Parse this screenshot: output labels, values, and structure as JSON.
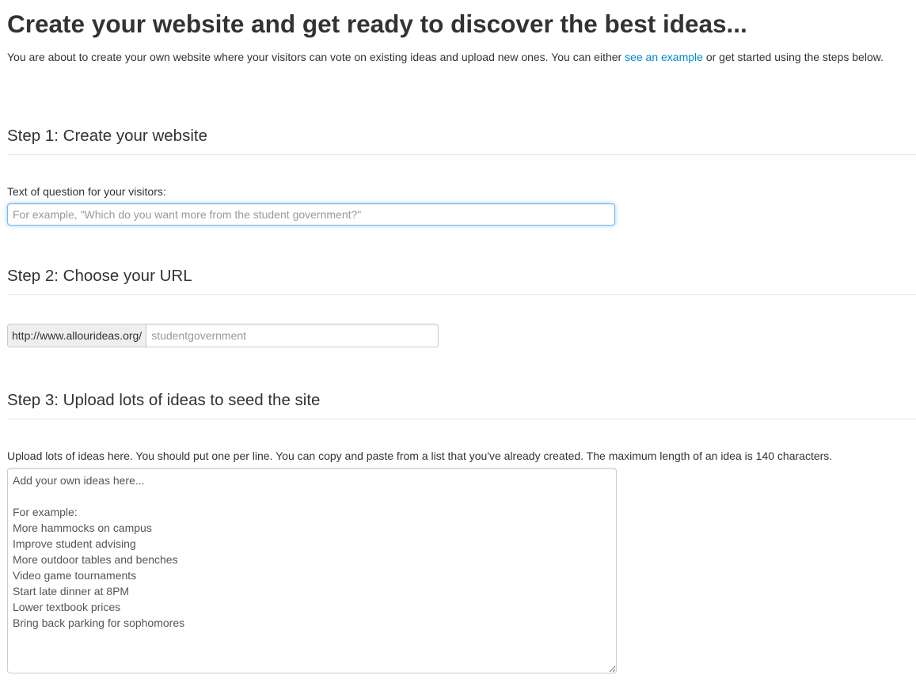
{
  "header": {
    "title": "Create your website and get ready to discover the best ideas...",
    "intro_before": "You are about to create your own website where your visitors can vote on existing ideas and upload new ones. You can either ",
    "intro_link": "see an example",
    "intro_after": " or get started using the steps below."
  },
  "step1": {
    "heading": "Step 1: Create your website",
    "question_label": "Text of question for your visitors:",
    "question_placeholder": "For example, \"Which do you want more from the student government?\"",
    "question_value": ""
  },
  "step2": {
    "heading": "Step 2: Choose your URL",
    "url_prefix": "http://www.allourideas.org/",
    "url_placeholder": "studentgovernment",
    "url_value": ""
  },
  "step3": {
    "heading": "Step 3: Upload lots of ideas to seed the site",
    "ideas_label": "Upload lots of ideas here. You should put one per line. You can copy and paste from a list that you've already created. The maximum length of an idea is 140 characters.",
    "ideas_text": "Add your own ideas here...\n\nFor example:\nMore hammocks on campus\nImprove student advising\nMore outdoor tables and benches\nVideo game tournaments\nStart late dinner at 8PM\nLower textbook prices\nBring back parking for sophomores"
  },
  "colors": {
    "link": "#0088cc",
    "focus_border": "#52a8ec",
    "text": "#333333"
  }
}
